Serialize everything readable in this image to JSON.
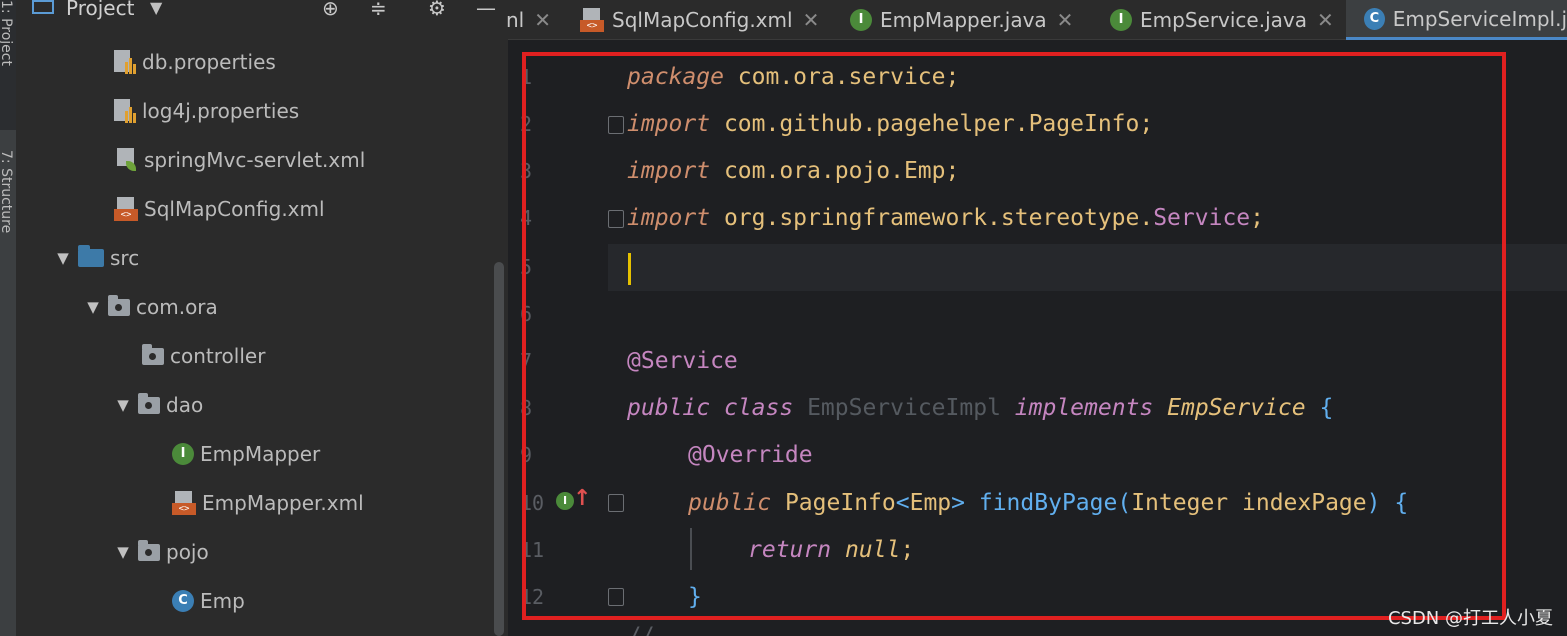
{
  "side_strip": {
    "project_tab": "1: Project",
    "structure_tab": "7: Structure"
  },
  "project_panel": {
    "title": "Project",
    "tree": [
      {
        "label": "db.properties",
        "icon": "properties-file-icon"
      },
      {
        "label": "log4j.properties",
        "icon": "properties-file-icon"
      },
      {
        "label": "springMvc-servlet.xml",
        "icon": "spring-xml-icon"
      },
      {
        "label": "SqlMapConfig.xml",
        "icon": "xml-file-icon"
      },
      {
        "label": "src",
        "icon": "source-folder-icon",
        "expanded": true
      },
      {
        "label": "com.ora",
        "icon": "package-icon",
        "expanded": true
      },
      {
        "label": "controller",
        "icon": "package-icon"
      },
      {
        "label": "dao",
        "icon": "package-icon",
        "expanded": true
      },
      {
        "label": "EmpMapper",
        "icon": "interface-icon"
      },
      {
        "label": "EmpMapper.xml",
        "icon": "xml-file-icon"
      },
      {
        "label": "pojo",
        "icon": "package-icon",
        "expanded": true
      },
      {
        "label": "Emp",
        "icon": "class-icon"
      }
    ]
  },
  "tabs": [
    {
      "label": "nl",
      "icon": "none"
    },
    {
      "label": "SqlMapConfig.xml",
      "icon": "xml-file-icon"
    },
    {
      "label": "EmpMapper.java",
      "icon": "interface-icon"
    },
    {
      "label": "EmpService.java",
      "icon": "interface-icon"
    },
    {
      "label": "EmpServiceImpl.j",
      "icon": "class-icon",
      "active": true
    }
  ],
  "editor": {
    "line_numbers": [
      "1",
      "2",
      "3",
      "4",
      "5",
      "6",
      "7",
      "8",
      "9",
      "10",
      "11",
      "12"
    ],
    "code": {
      "l1": {
        "kw": "package",
        "rest": " com.ora.service;"
      },
      "l2": {
        "kw": "import",
        "rest": " com.github.pagehelper.PageInfo;"
      },
      "l3": {
        "kw": "import",
        "rest": " com.ora.pojo.Emp;"
      },
      "l4": {
        "kw": "import",
        "pkg": " org.springframework.stereotype.",
        "cls": "Service",
        "end": ";"
      },
      "l7": {
        "ann": "@Service"
      },
      "l8": {
        "kw1": "public",
        "kw2": "class",
        "name": "EmpServiceImpl",
        "kw3": "implements",
        "iface": "EmpService",
        "brace": "{"
      },
      "l9": {
        "ann": "@Override"
      },
      "l10": {
        "kw": "public",
        "ret": "PageInfo",
        "lt": "<",
        "targ": "Emp",
        "gt": ">",
        "method": "findByPage",
        "lp": "(",
        "ptype": "Integer",
        "pname": "indexPage",
        "rp": ")",
        "brace": "{"
      },
      "l11": {
        "kw": "return",
        "val": "null",
        "semi": ";"
      },
      "l12": {
        "brace": "}"
      }
    },
    "next_line_hint": "// ..."
  },
  "watermark": "CSDN @打工人小夏",
  "colors": {
    "highlight_box": "#e02020",
    "caret": "#e5c100",
    "active_tab_underline": "#4a88c7"
  }
}
